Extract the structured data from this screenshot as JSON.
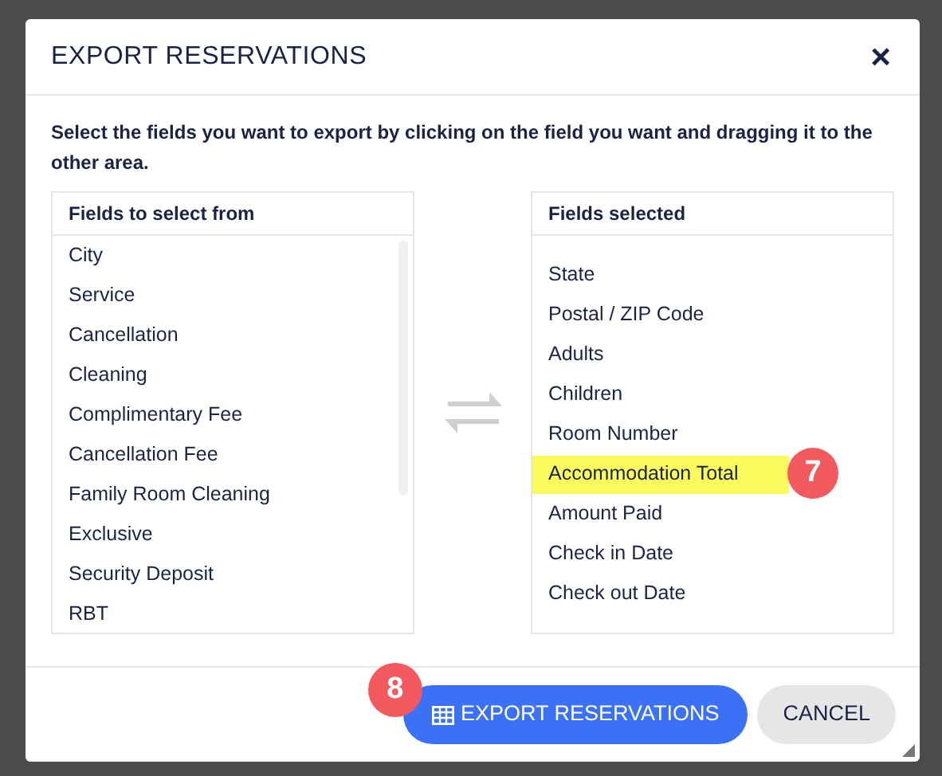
{
  "dialog": {
    "title": "EXPORT RESERVATIONS",
    "close": "×"
  },
  "instructions": "Select the fields you want to export by clicking on the field you want and dragging it to the other area.",
  "available": {
    "heading": "Fields to select from",
    "items": [
      {
        "label": "City",
        "highlighted": false
      },
      {
        "label": "Service",
        "highlighted": false
      },
      {
        "label": "Cancellation",
        "highlighted": false
      },
      {
        "label": "Cleaning",
        "highlighted": false
      },
      {
        "label": "Complimentary Fee",
        "highlighted": false
      },
      {
        "label": "Cancellation Fee",
        "highlighted": false
      },
      {
        "label": "Family Room Cleaning",
        "highlighted": false
      },
      {
        "label": "Exclusive",
        "highlighted": false
      },
      {
        "label": "Security Deposit",
        "highlighted": false
      },
      {
        "label": "RBT",
        "highlighted": false
      }
    ]
  },
  "selected": {
    "heading": "Fields selected",
    "items": [
      {
        "label": "State",
        "highlighted": false
      },
      {
        "label": "Postal / ZIP Code",
        "highlighted": false
      },
      {
        "label": "Adults",
        "highlighted": false
      },
      {
        "label": "Children",
        "highlighted": false
      },
      {
        "label": "Room Number",
        "highlighted": false
      },
      {
        "label": "Accommodation Total",
        "highlighted": true,
        "callout": "7"
      },
      {
        "label": "Amount Paid",
        "highlighted": false
      },
      {
        "label": "Check in Date",
        "highlighted": false
      },
      {
        "label": "Check out Date",
        "highlighted": false
      }
    ]
  },
  "buttons": [
    {
      "kind": "primary",
      "label": "EXPORT RESERVATIONS",
      "callout": "8"
    },
    {
      "kind": "secondary",
      "label": "CANCEL"
    }
  ]
}
